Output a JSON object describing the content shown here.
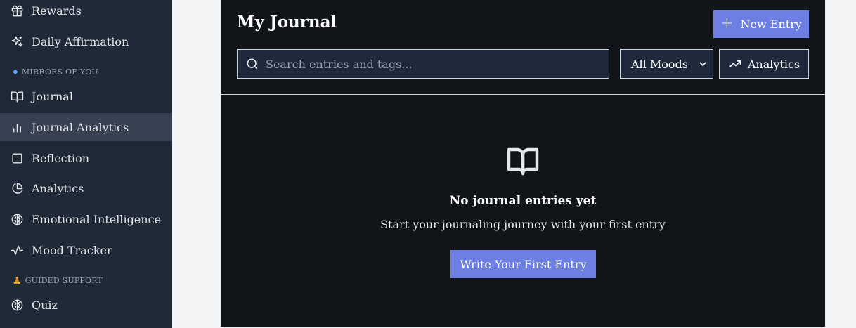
{
  "sidebar": {
    "items": [
      {
        "label": "Rewards",
        "icon": "gift-icon"
      },
      {
        "label": "Daily Affirmation",
        "icon": "sparkles-icon"
      },
      {
        "label": "Journal",
        "icon": "book-open-icon"
      },
      {
        "label": "Journal Analytics",
        "icon": "bar-chart-icon",
        "active": true
      },
      {
        "label": "Reflection",
        "icon": "square-icon"
      },
      {
        "label": "Analytics",
        "icon": "pie-chart-icon"
      },
      {
        "label": "Emotional Intelligence",
        "icon": "brain-icon"
      },
      {
        "label": "Mood Tracker",
        "icon": "activity-icon"
      },
      {
        "label": "Quiz",
        "icon": "brain-icon"
      }
    ],
    "sections": [
      {
        "label": "MIRRORS OF YOU",
        "marker": "◆",
        "marker_color": "#60a5fa"
      },
      {
        "label": "GUIDED SUPPORT",
        "marker": "🧘",
        "marker_color": "#f59e0b"
      }
    ]
  },
  "main": {
    "title": "My Journal",
    "new_entry_label": "New Entry",
    "search": {
      "placeholder": "Search entries and tags...",
      "value": ""
    },
    "mood_filter": {
      "selected": "All Moods"
    },
    "analytics_label": "Analytics",
    "empty_state": {
      "icon": "book-open-icon",
      "title": "No journal entries yet",
      "subtitle": "Start your journaling journey with your first entry",
      "button_label": "Write Your First Entry"
    }
  },
  "colors": {
    "accent": "#6d7fe3",
    "sidebar_bg": "#1f2937",
    "panel_bg": "#111418",
    "page_bg": "#f3f4f6"
  }
}
